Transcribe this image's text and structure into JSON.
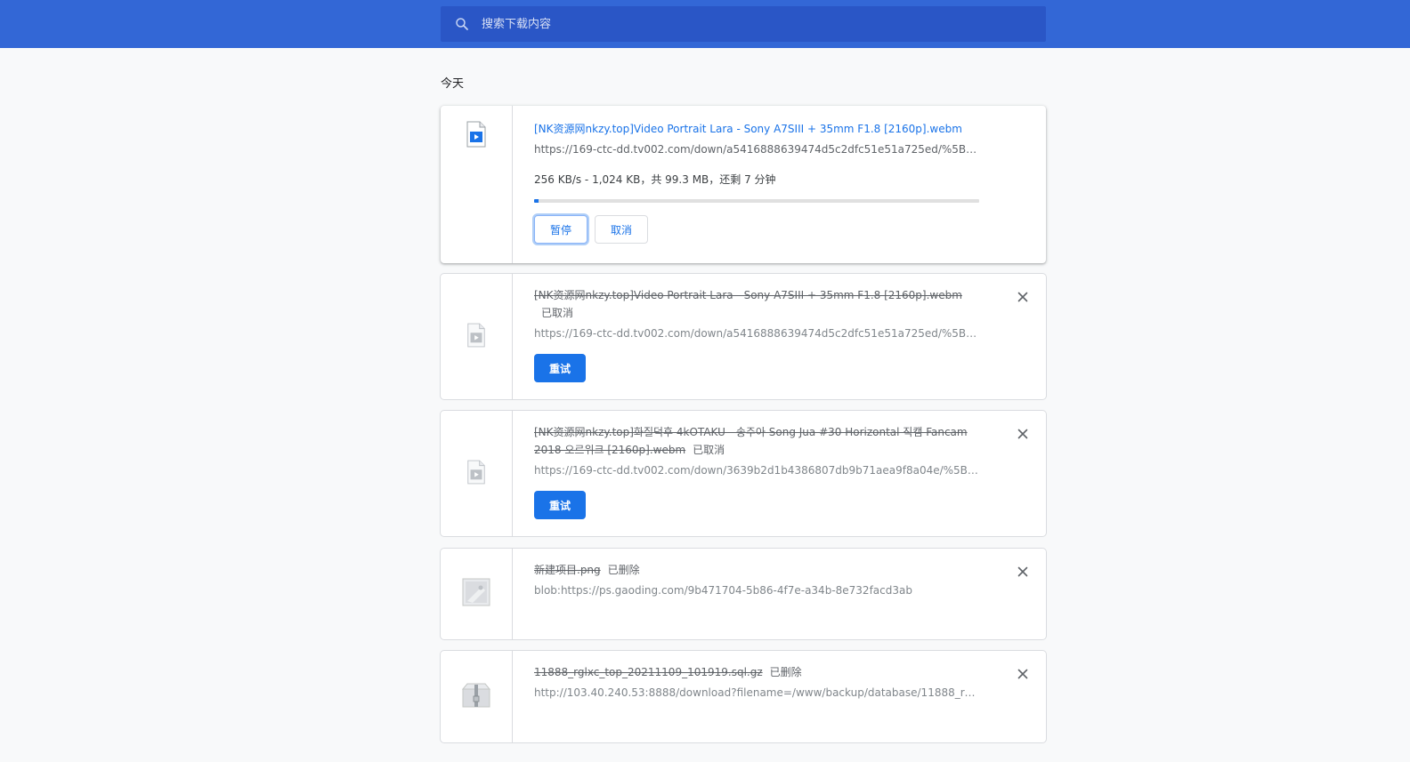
{
  "search": {
    "placeholder": "搜索下载内容"
  },
  "section": {
    "date": "今天"
  },
  "downloads": [
    {
      "name": "[NK资源网nkzy.top]Video Portrait Lara - Sony A7SIII + 35mm F1.8 [2160p].webm",
      "url": "https://169-ctc-dd.tv002.com/down/a5416888639474d5c2dfc51e51a725ed/%5BNK...",
      "status_text": "256 KB/s - 1,024 KB，共 99.3 MB，还剩 7 分钟",
      "progress": 0.01,
      "pause_label": "暂停",
      "cancel_label": "取消",
      "icon": "video-file-icon"
    },
    {
      "name": "[NK资源网nkzy.top]Video Portrait Lara - Sony A7SIII + 35mm F1.8 [2160p].webm",
      "tag": "已取消",
      "url": "https://169-ctc-dd.tv002.com/down/a5416888639474d5c2dfc51e51a725ed/%5BNK...",
      "retry_label": "重试",
      "icon": "video-file-icon"
    },
    {
      "name": "[NK资源网nkzy.top]화질덕후 4kOTAKU - 송주아 Song Jua #30 Horizontal 직캠 Fancam 2018 오르위크 [2160p].webm",
      "tag": "已取消",
      "url": "https://169-ctc-dd.tv002.com/down/3639b2d1b4386807db9b71aea9f8a04e/%5BNK...",
      "retry_label": "重试",
      "icon": "video-file-icon"
    },
    {
      "name": "新建项目.png",
      "tag": "已删除",
      "url": "blob:https://ps.gaoding.com/9b471704-5b86-4f7e-a34b-8e732facd3ab",
      "icon": "image-file-icon"
    },
    {
      "name": "11888_rglxc_top_20211109_101919.sql.gz",
      "tag": "已删除",
      "url": "http://103.40.240.53:8888/download?filename=/www/backup/database/11888_rglx...",
      "icon": "archive-file-icon"
    }
  ],
  "colors": {
    "header": "#3367d6",
    "search_bg": "#2a56c6",
    "accent": "#1a73e8",
    "page_bg": "#f8f9fa"
  }
}
